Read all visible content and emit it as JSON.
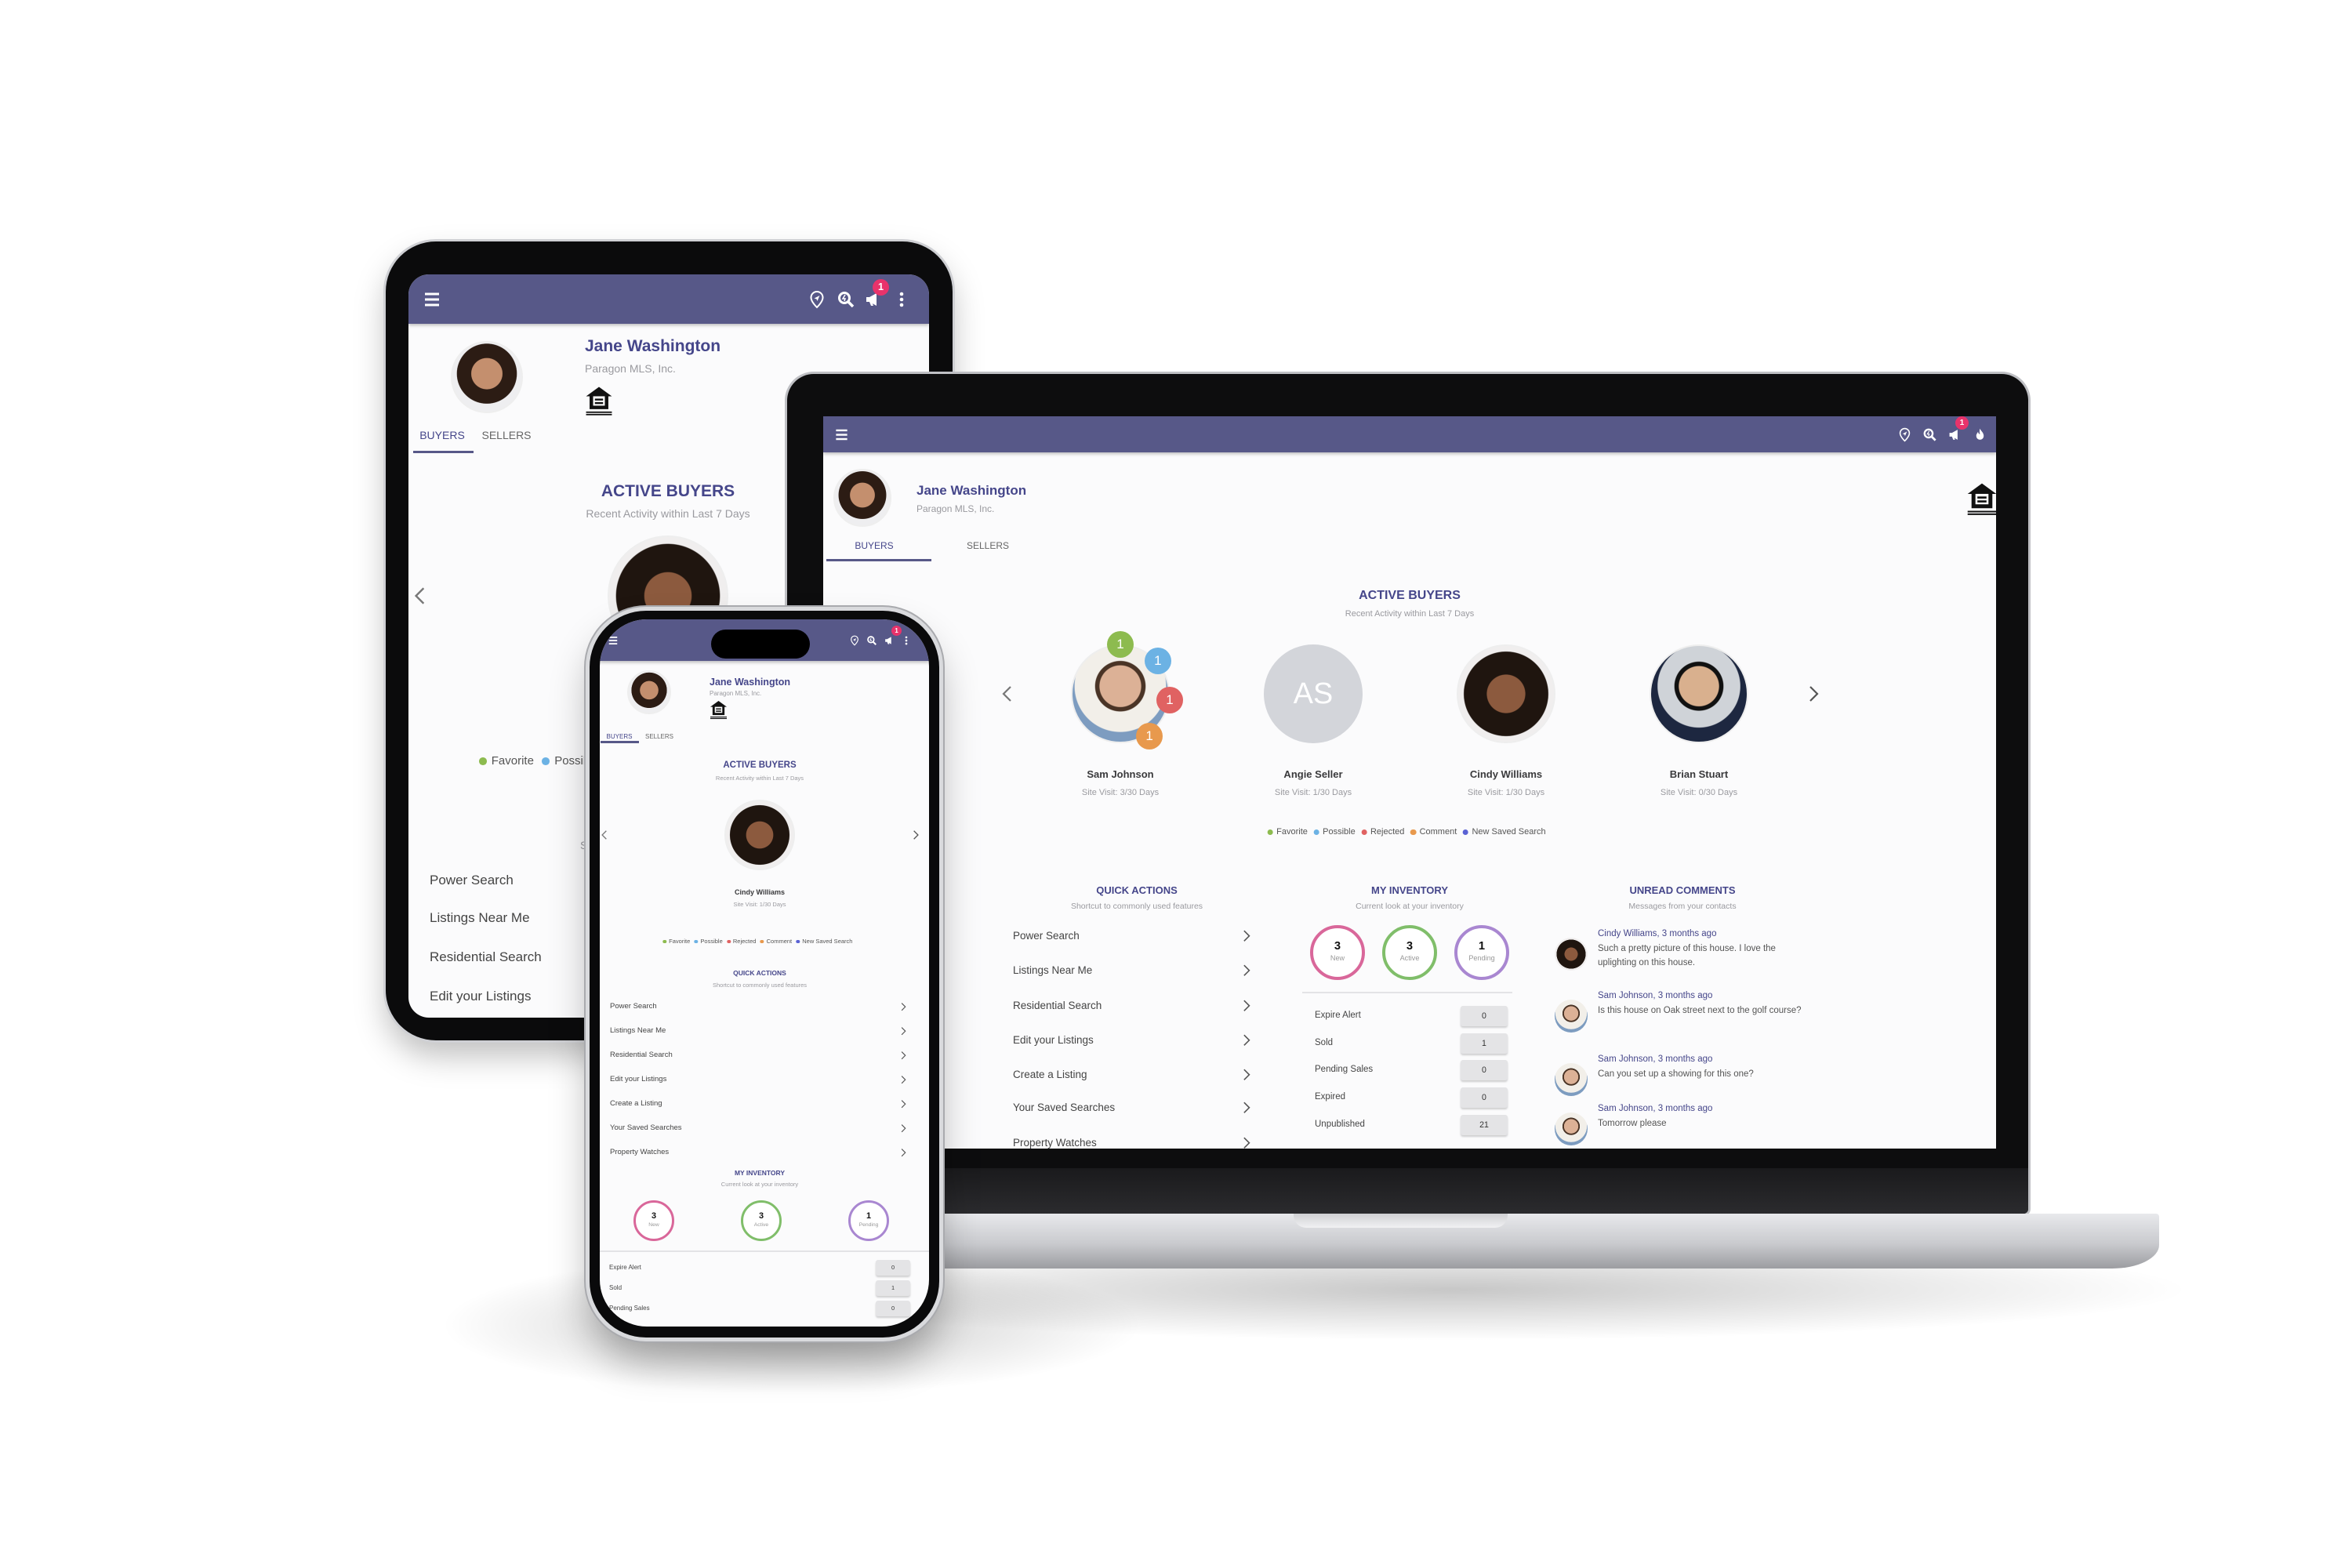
{
  "app": {
    "user_name": "Jane Washington",
    "company": "Paragon MLS, Inc.",
    "notification_count": "1",
    "tabs": [
      "BUYERS",
      "SELLERS"
    ],
    "active_tab": "BUYERS",
    "header_icons": [
      "menu-icon",
      "location-pin-icon",
      "search-icon",
      "megaphone-icon",
      "fire-icon",
      "more-vert-icon"
    ],
    "logo": "equal-housing-opportunity"
  },
  "active_buyers": {
    "title": "ACTIVE BUYERS",
    "subtitle": "Recent Activity within Last 7 Days",
    "buyers": [
      {
        "name": "Sam Johnson",
        "site_visit": "Site Visit: 3/30 Days",
        "badges": [
          {
            "type": "Favorite",
            "count": "1"
          },
          {
            "type": "Possible",
            "count": "1"
          },
          {
            "type": "Rejected",
            "count": "1"
          },
          {
            "type": "Comment",
            "count": "1"
          }
        ]
      },
      {
        "name": "Angie Seller",
        "site_visit": "Site Visit: 1/30 Days",
        "initials": "AS"
      },
      {
        "name": "Cindy Williams",
        "site_visit": "Site Visit: 1/30 Days"
      },
      {
        "name": "Brian Stuart",
        "site_visit": "Site Visit: 0/30 Days"
      }
    ]
  },
  "legend": [
    {
      "label": "Favorite",
      "color": "#8dbb4f"
    },
    {
      "label": "Possible",
      "color": "#6cb2e4"
    },
    {
      "label": "Rejected",
      "color": "#e06262"
    },
    {
      "label": "Comment",
      "color": "#e8994d"
    },
    {
      "label": "New Saved Search",
      "color": "#5a62d4"
    }
  ],
  "quick_actions": {
    "title": "QUICK ACTIONS",
    "subtitle": "Shortcut to commonly used features",
    "items": [
      "Power Search",
      "Listings Near Me",
      "Residential Search",
      "Edit your Listings",
      "Create a Listing",
      "Your Saved Searches",
      "Property Watches"
    ]
  },
  "inventory": {
    "title": "MY INVENTORY",
    "subtitle": "Current look at your inventory",
    "circles": [
      {
        "value": "3",
        "label": "New",
        "color": "#d9679a"
      },
      {
        "value": "3",
        "label": "Active",
        "color": "#80be6a"
      },
      {
        "value": "1",
        "label": "Pending",
        "color": "#a987d1"
      }
    ],
    "rows": [
      {
        "label": "Expire Alert",
        "value": "0"
      },
      {
        "label": "Sold",
        "value": "1"
      },
      {
        "label": "Pending Sales",
        "value": "0"
      },
      {
        "label": "Expired",
        "value": "0"
      },
      {
        "label": "Unpublished",
        "value": "21"
      }
    ]
  },
  "comments": {
    "title": "UNREAD COMMENTS",
    "subtitle": "Messages from your contacts",
    "items": [
      {
        "author_time": "Cindy Williams, 3 months ago",
        "text": "Such a pretty picture of this house. I love the uplighting on this house."
      },
      {
        "author_time": "Sam Johnson, 3 months ago",
        "text": "Is this house on Oak street next to the golf course?"
      },
      {
        "author_time": "Sam Johnson, 3 months ago",
        "text": "Can you set up a showing for this one?"
      },
      {
        "author_time": "Sam Johnson, 3 months ago",
        "text": "Tomorrow please"
      }
    ]
  },
  "colors": {
    "header": "#575888",
    "accent_text": "#45468a",
    "notification_badge": "#e8336b"
  }
}
